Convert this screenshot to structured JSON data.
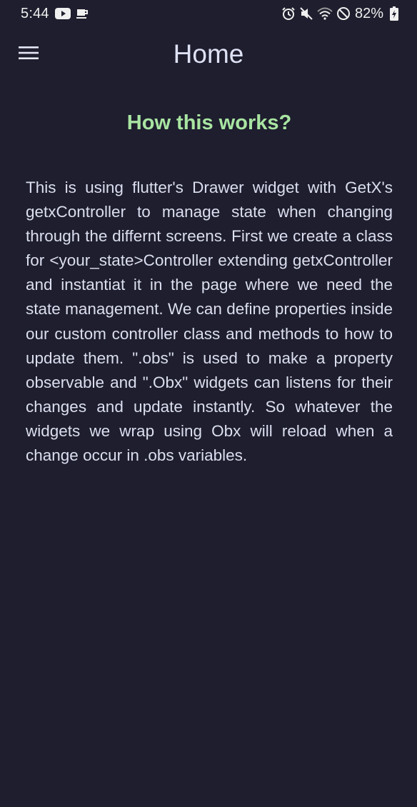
{
  "status_bar": {
    "time": "5:44",
    "battery": "82%",
    "icons": [
      "youtube-icon",
      "coffee-icon",
      "alarm-icon",
      "mute-icon",
      "wifi-icon",
      "do-not-disturb-icon",
      "battery-charging-icon"
    ]
  },
  "app_bar": {
    "title": "Home",
    "menu_icon": "hamburger-menu-icon"
  },
  "main": {
    "heading": "How this works?",
    "body": "This is using flutter's Drawer widget with GetX's getxController to manage state when changing through the differnt screens. First we create a class for <your_state>Controller extending getxController and instantiat it in the page where we need the state management. We can define properties inside our custom controller class and methods to how to update them. \".obs\" is used to make a property observable and \".Obx\" widgets can listens for their changes and update instantly. So whatever the widgets we wrap using Obx will reload when a change occur in .obs variables."
  },
  "colors": {
    "background": "#1e1e2e",
    "heading": "#a9e5a2",
    "text": "#dcdff0"
  }
}
